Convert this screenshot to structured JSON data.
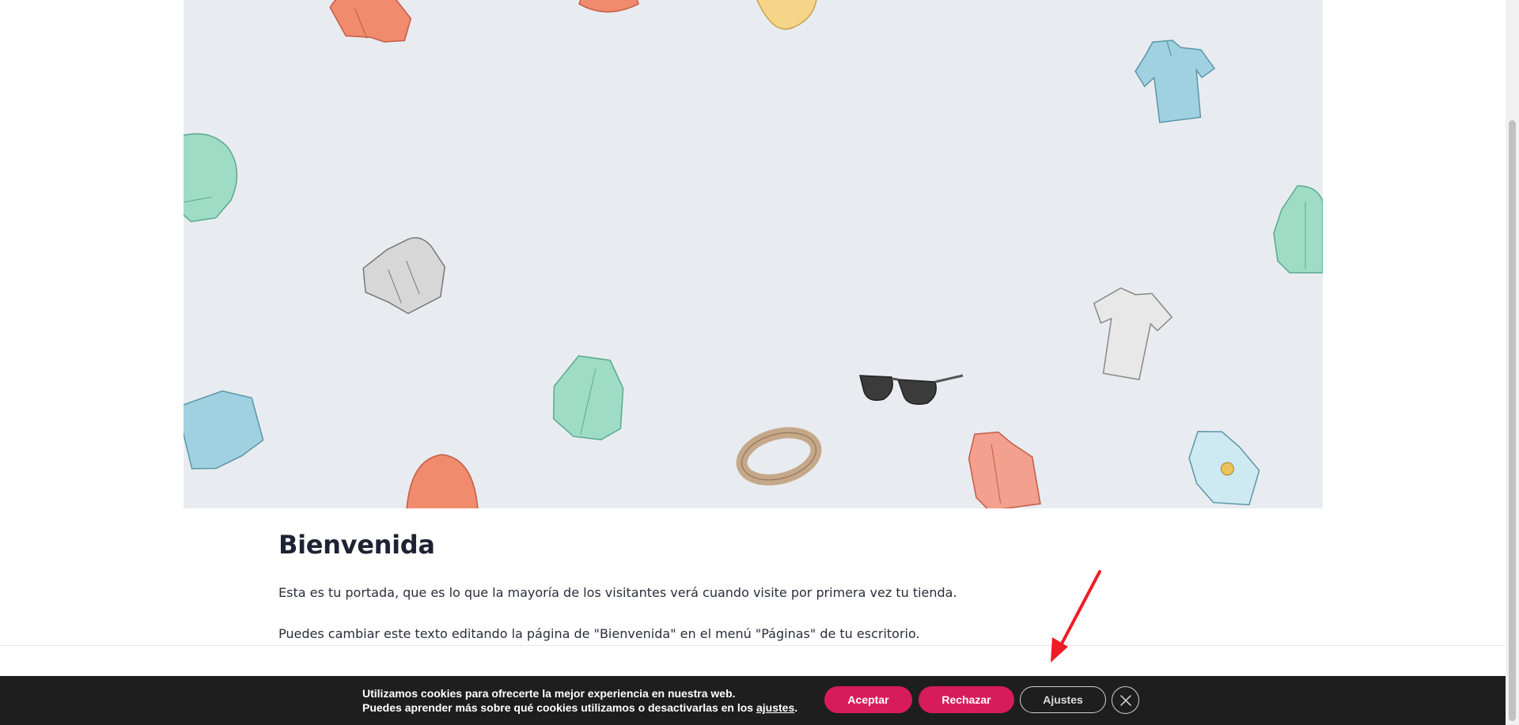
{
  "welcome": {
    "title": "Bienvenida",
    "paragraph_1": "Esta es tu portada, que es lo que la mayoría de los visitantes verá cuando visite por primera vez tu tienda.",
    "paragraph_2": "Puedes cambiar este texto editando la página de \"Bienvenida\" en el menú \"Páginas\" de tu escritorio."
  },
  "cookie_notice": {
    "line_1": "Utilizamos cookies para ofrecerte la mejor experiencia en nuestra web.",
    "line_2_prefix": "Puedes aprender más sobre qué cookies utilizamos o desactivarlas en los ",
    "line_2_link": "ajustes",
    "line_2_suffix": ".",
    "accept_label": "Aceptar",
    "reject_label": "Rechazar",
    "settings_label": "Ajustes",
    "close_icon": "close-icon"
  },
  "colors": {
    "hero_background": "#e8ecf0",
    "cookie_bar": "#1e1e1e",
    "accent": "#d81b5a",
    "annotation_arrow": "#ee1c25"
  },
  "hero_items": [
    "orange-jacket-icon",
    "red-hat-icon",
    "yellow-hat-icon",
    "blue-polo-icon",
    "green-sweater-icon",
    "grey-hoodie-icon",
    "green-hoodie-icon",
    "white-tshirt-icon",
    "sunglasses-icon",
    "belt-icon",
    "pink-hoodie-icon",
    "blue-hoodie-icon",
    "red-beanie-icon",
    "blue-shirt-icon"
  ]
}
